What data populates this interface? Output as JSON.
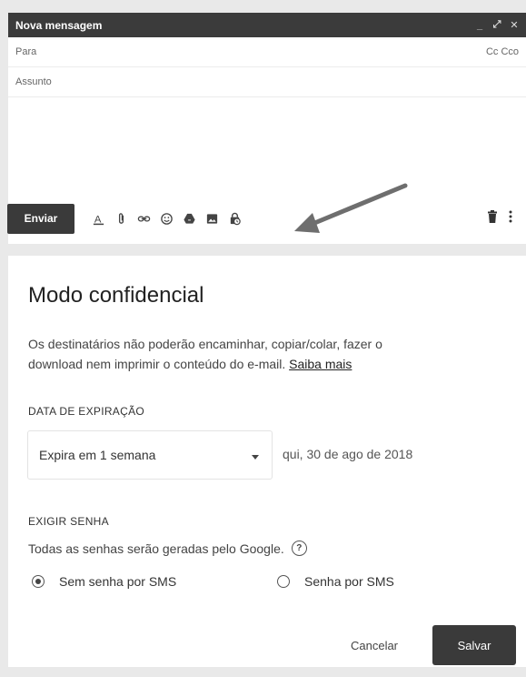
{
  "compose": {
    "title": "Nova mensagem",
    "to_label": "Para",
    "cc_label": "Cc Cco",
    "subject_label": "Assunto",
    "send_label": "Enviar",
    "toolbar_icons": [
      "text-format-icon",
      "attach-icon",
      "link-icon",
      "emoji-icon",
      "drive-icon",
      "photo-icon",
      "confidential-mode-icon",
      "trash-icon",
      "more-options-icon"
    ]
  },
  "dialog": {
    "title": "Modo confidencial",
    "desc_line1": "Os destinatários não poderão encaminhar, copiar/colar, fazer o",
    "desc_line2": "download nem imprimir o conteúdo do e-mail.",
    "learn_more": "Saiba mais",
    "expiration_label": "DATA DE EXPIRAÇÃO",
    "expiration_value": "Expira em 1 semana",
    "expiration_date": "qui, 30 de ago de 2018",
    "password_label": "EXIGIR SENHA",
    "password_desc": "Todas as senhas serão geradas pelo Google.",
    "option_no_sms": "Sem senha por SMS",
    "option_sms": "Senha por SMS",
    "selected_option": "Sem senha por SMS",
    "cancel_label": "Cancelar",
    "save_label": "Salvar"
  },
  "colors": {
    "header_bg": "#3b3b3b",
    "button_bg": "#3a3a3a",
    "arrow": "#6e6e6e"
  }
}
